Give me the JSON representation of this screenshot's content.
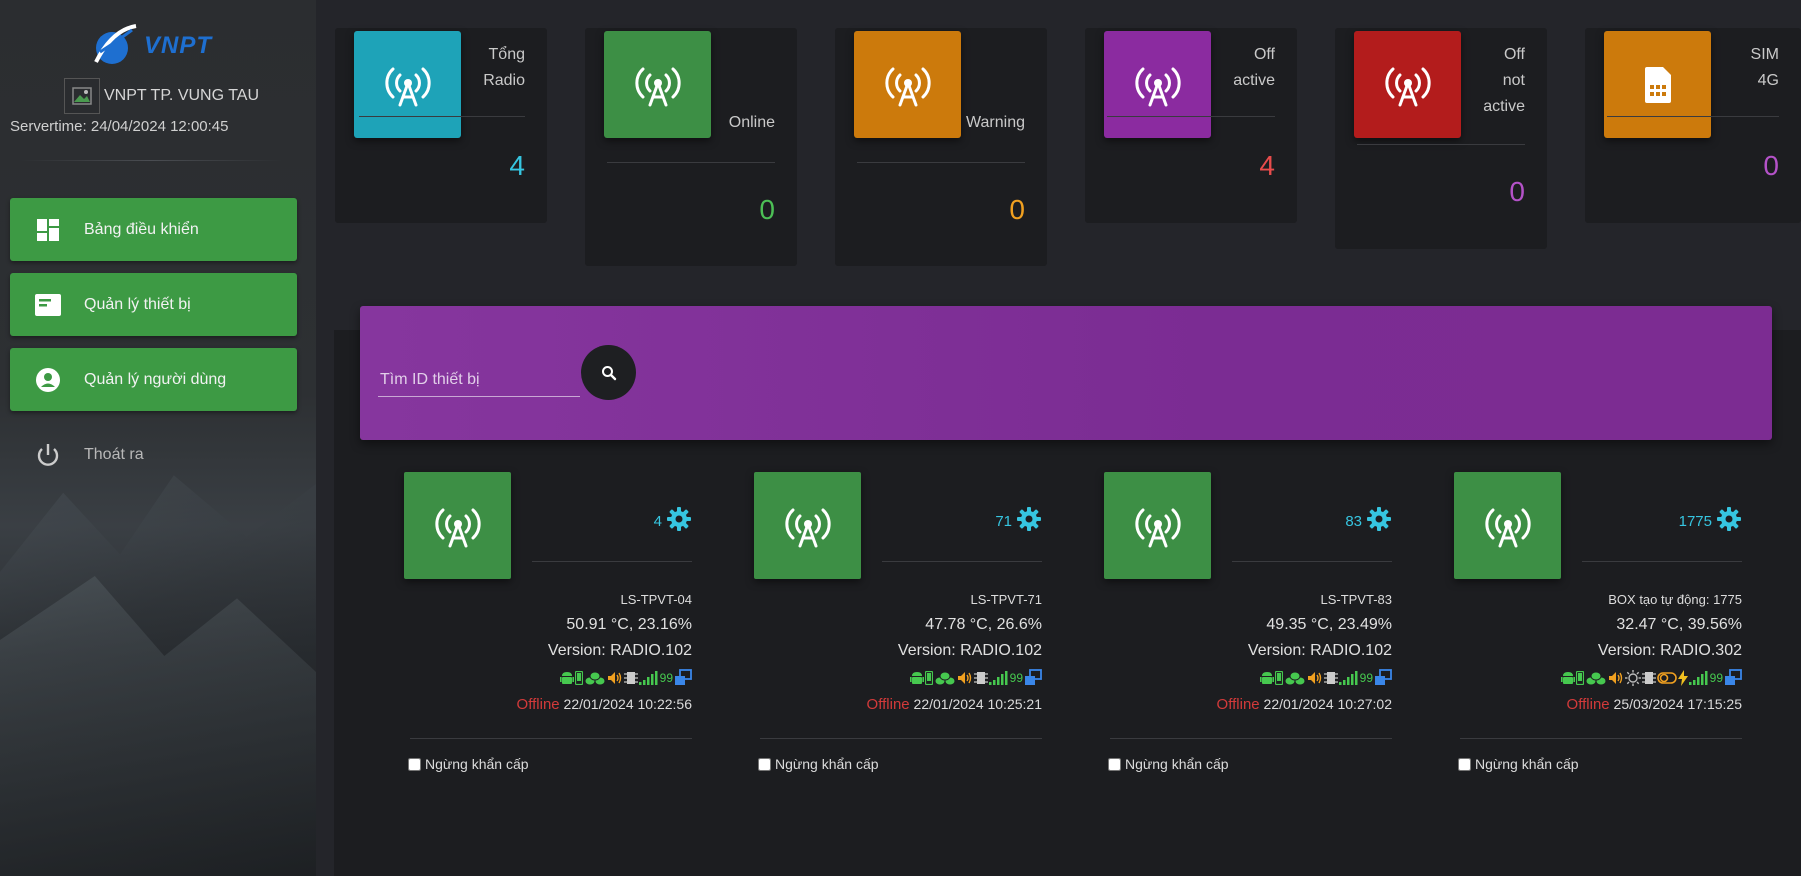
{
  "brand": {
    "logo_text": "VNPT",
    "org_name": "VNPT TP. VUNG TAU",
    "servertime": "Servertime: 24/04/2024 12:00:45"
  },
  "nav": {
    "dashboard": "Bảng điều khiển",
    "devices": "Quản lý thiết bị",
    "users": "Quản lý người dùng",
    "logout": "Thoát ra"
  },
  "stats": [
    {
      "label1": "Tổng",
      "label2": "Radio",
      "label3": "",
      "value": "4",
      "color": "#1ea3b8",
      "value_color": "#36c5e0",
      "icon": "radio-tower-icon"
    },
    {
      "label1": "",
      "label2": "",
      "label3": "Online",
      "value": "0",
      "color": "#3d8f45",
      "value_color": "#4cbf55",
      "icon": "radio-tower-icon"
    },
    {
      "label1": "",
      "label2": "",
      "label3": "Warning",
      "value": "0",
      "color": "#cc7a0c",
      "value_color": "#f0a020",
      "icon": "radio-tower-icon"
    },
    {
      "label1": "Off",
      "label2": "active",
      "label3": "",
      "value": "4",
      "color": "#8b2ba0",
      "value_color": "#e84c4c",
      "icon": "radio-tower-icon"
    },
    {
      "label1": "Off",
      "label2": "not",
      "label3": "active",
      "value": "0",
      "color": "#b31c1c",
      "value_color": "#b452c8",
      "icon": "radio-tower-icon"
    },
    {
      "label1": "SIM",
      "label2": "4G",
      "label3": "",
      "value": "0",
      "color": "#cc7a0c",
      "value_color": "#b452c8",
      "icon": "sim-card-icon"
    }
  ],
  "search": {
    "placeholder": "Tìm ID thiết bị"
  },
  "devices": [
    {
      "id": "4",
      "name": "LS-TPVT-04",
      "env": "50.91 °C, 23.16%",
      "version": "Version: RADIO.102",
      "signal": "99",
      "status": "Offline",
      "time": "22/01/2024 10:22:56",
      "emergency_label": "Ngừng khẩn cấp"
    },
    {
      "id": "71",
      "name": "LS-TPVT-71",
      "env": "47.78 °C, 26.6%",
      "version": "Version: RADIO.102",
      "signal": "99",
      "status": "Offline",
      "time": "22/01/2024 10:25:21",
      "emergency_label": "Ngừng khẩn cấp"
    },
    {
      "id": "83",
      "name": "LS-TPVT-83",
      "env": "49.35 °C, 23.49%",
      "version": "Version: RADIO.102",
      "signal": "99",
      "status": "Offline",
      "time": "22/01/2024 10:27:02",
      "emergency_label": "Ngừng khẩn cấp"
    },
    {
      "id": "1775",
      "name": "BOX tạo tự động: 1775",
      "env": "32.47 °C, 39.56%",
      "version": "Version: RADIO.302",
      "signal": "99",
      "status": "Offline",
      "time": "25/03/2024 17:15:25",
      "emergency_label": "Ngừng khẩn cấp"
    }
  ]
}
